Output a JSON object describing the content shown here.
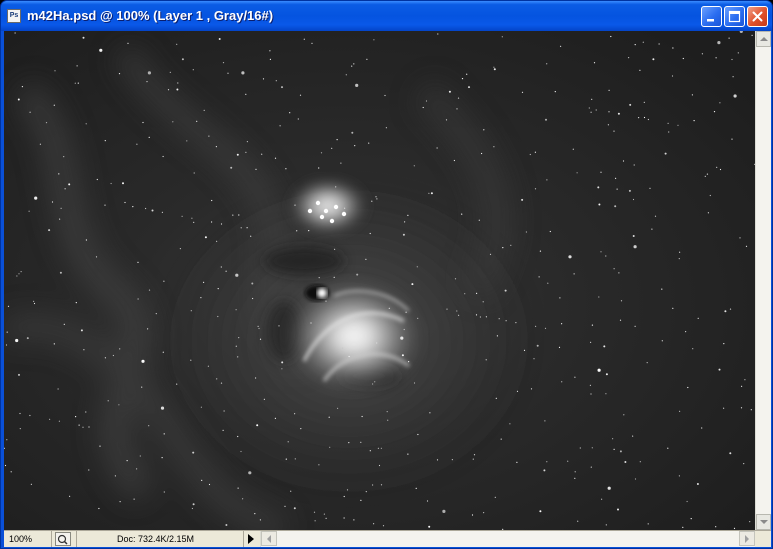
{
  "window": {
    "app_icon_label": "Ps",
    "title": "m42Ha.psd @ 100% (Layer 1 , Gray/16#)",
    "buttons": {
      "minimize": "minimize-icon",
      "maximize": "maximize-icon",
      "close": "close-icon"
    },
    "colors": {
      "titlebar": "#0554e0",
      "close_button": "#e0502a"
    }
  },
  "canvas": {
    "content": "grayscale astrophotograph of a nebula in a star field",
    "background": "#222222"
  },
  "status_bar": {
    "zoom": "100%",
    "doc_info": "Doc: 732.4K/2.15M"
  }
}
